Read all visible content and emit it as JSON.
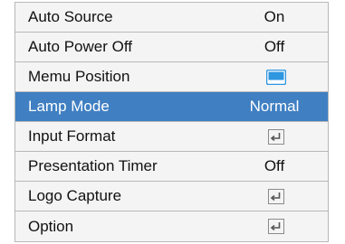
{
  "menu": {
    "items": [
      {
        "label": "Auto Source",
        "value": "On",
        "kind": "text"
      },
      {
        "label": "Auto Power Off",
        "value": "Off",
        "kind": "text"
      },
      {
        "label": "Memu Position",
        "value": "",
        "kind": "position-icon"
      },
      {
        "label": "Lamp Mode",
        "value": "Normal",
        "kind": "text",
        "selected": true
      },
      {
        "label": "Input Format",
        "value": "",
        "kind": "enter-icon"
      },
      {
        "label": "Presentation Timer",
        "value": "Off",
        "kind": "text"
      },
      {
        "label": "Logo Capture",
        "value": "",
        "kind": "enter-icon"
      },
      {
        "label": "Option",
        "value": "",
        "kind": "enter-icon"
      }
    ]
  },
  "colors": {
    "selected_row": "#3f7fc2",
    "row_background": "#f4f4f4",
    "divider": "#b8b8b8",
    "position_icon_fill": "#2f96e0"
  }
}
